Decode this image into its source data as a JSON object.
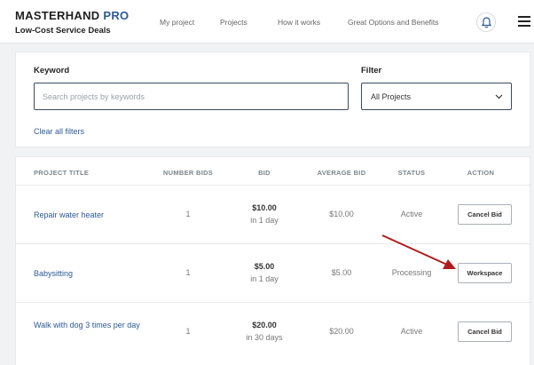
{
  "header": {
    "brand": "MASTERHAND",
    "brand_suffix": "PRO",
    "tagline": "Low-Cost Service Deals",
    "nav": [
      "My project",
      "Projects",
      "How it works",
      "Great Options and Benefits"
    ]
  },
  "filters": {
    "keyword_label": "Keyword",
    "search_placeholder": "Search projects by keywords",
    "search_value": "",
    "filter_label": "Filter",
    "filter_value": "All Projects",
    "clear_label": "Clear all filters"
  },
  "table": {
    "headers": [
      "PROJECT TITLE",
      "NUMBER BIDS",
      "BID",
      "AVERAGE BID",
      "STATUS",
      "ACTION"
    ],
    "rows": [
      {
        "title": "Repair water heater",
        "bids": "1",
        "bid": "$10.00",
        "bid_time": "in 1 day",
        "avg": "$10.00",
        "status": "Active",
        "action": "Cancel Bid"
      },
      {
        "title": "Babysitting",
        "bids": "1",
        "bid": "$5.00",
        "bid_time": "in 1 day",
        "avg": "$5.00",
        "status": "Processing",
        "action": "Workspace"
      },
      {
        "title": "Walk with dog 3 times per day",
        "bids": "1",
        "bid": "$20.00",
        "bid_time": "in 30 days",
        "avg": "$20.00",
        "status": "Active",
        "action": "Cancel Bid"
      }
    ]
  },
  "icons": {
    "bell": "bell-icon",
    "menu": "hamburger-menu-icon",
    "dropdown": "chevron-down-icon",
    "annotation": "red-arrow-annotation"
  },
  "colors": {
    "brand_accent": "#2c5a95",
    "link": "#2c5a95",
    "annotation": "#b01c1c"
  }
}
